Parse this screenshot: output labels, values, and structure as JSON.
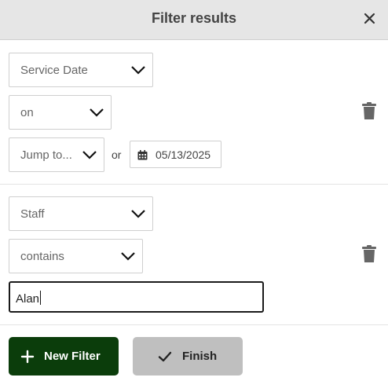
{
  "header": {
    "title": "Filter results",
    "close_icon": "close-icon"
  },
  "filters": [
    {
      "field": "Service Date",
      "operator": "on",
      "jump": "Jump to...",
      "or_label": "or",
      "date": "05/13/2025",
      "delete_icon": "trash-icon"
    },
    {
      "field": "Staff",
      "operator": "contains",
      "value": "Alan",
      "delete_icon": "trash-icon"
    }
  ],
  "actions": {
    "new_filter": "New Filter",
    "finish": "Finish"
  },
  "colors": {
    "primary": "#0b3d0b",
    "secondary": "#bfbfbf",
    "header_bg": "#e6e6e6"
  }
}
